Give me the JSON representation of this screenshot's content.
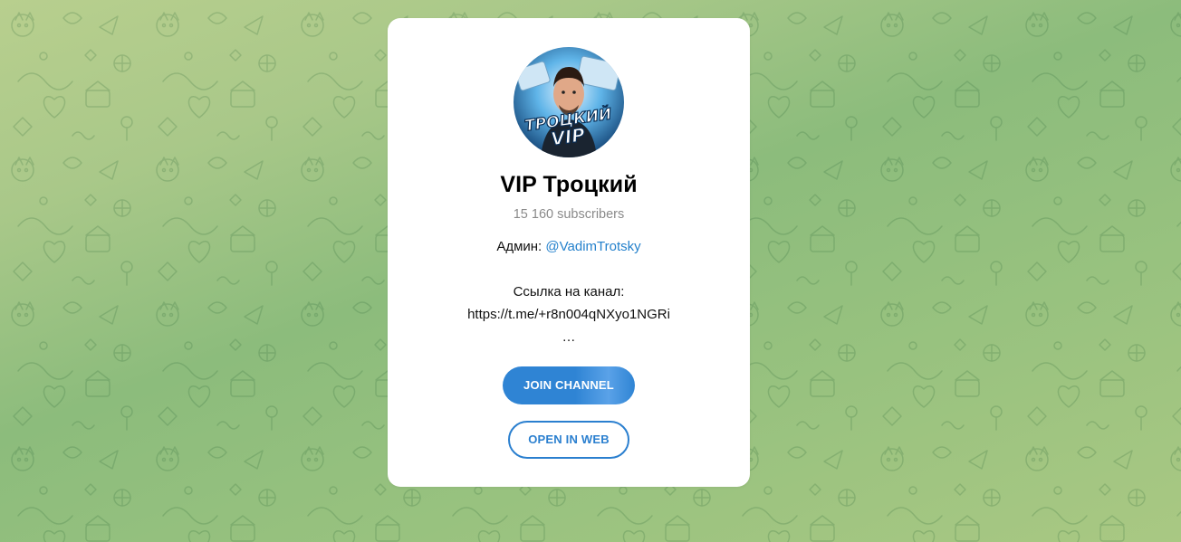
{
  "channel": {
    "title": "VIP Троцкий",
    "subscribers": "15 160 subscribers",
    "avatar_text_line1": "ТРОЦКИЙ",
    "avatar_text_line2": "VIP"
  },
  "description": {
    "admin_prefix": "Админ: ",
    "admin_handle": "@VadimTrotsky",
    "link_label": "Ссылка на канал:",
    "link_url": "https://t.me/+r8n004qNXyo1NGRi",
    "ellipsis": "…"
  },
  "buttons": {
    "join_label": "JOIN CHANNEL",
    "open_web_label": "OPEN IN WEB"
  },
  "colors": {
    "accent": "#2481cc",
    "background": "#a9c889"
  }
}
